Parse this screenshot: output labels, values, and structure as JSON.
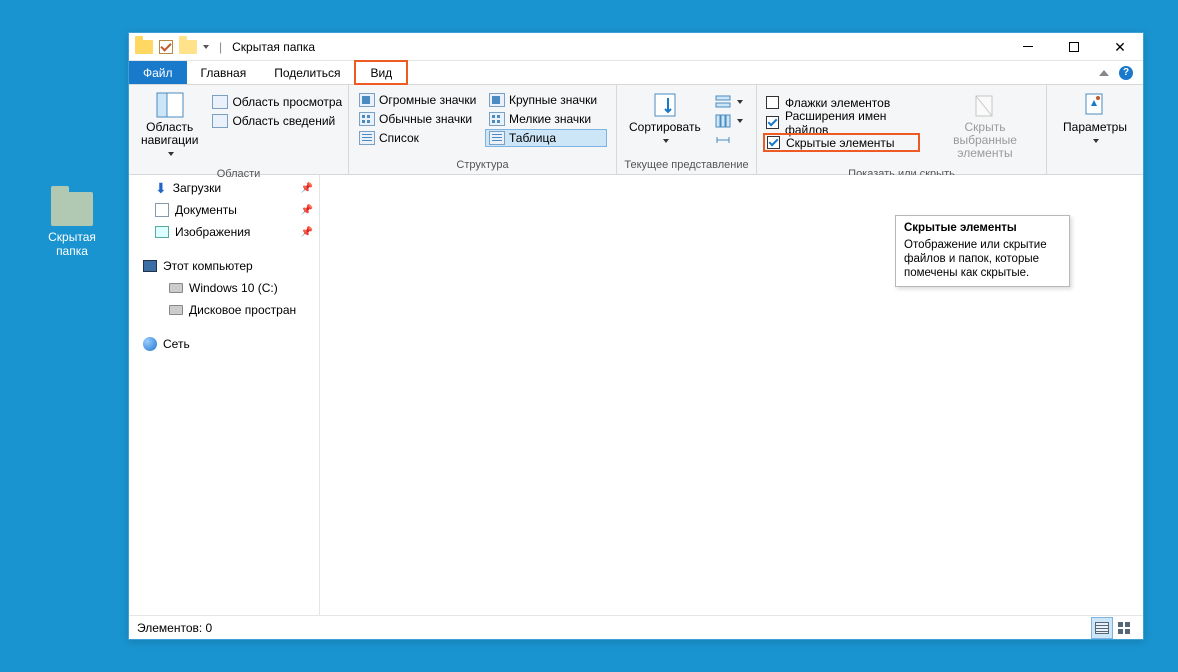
{
  "desktop": {
    "folder_label_l1": "Скрытая",
    "folder_label_l2": "папка"
  },
  "titlebar": {
    "title": "Скрытая папка"
  },
  "tabs": {
    "file": "Файл",
    "home": "Главная",
    "share": "Поделиться",
    "view": "Вид"
  },
  "ribbon": {
    "panes": {
      "nav_l1": "Область",
      "nav_l2": "навигации",
      "preview": "Область просмотра",
      "details": "Область сведений",
      "group": "Области"
    },
    "layout": {
      "xl": "Огромные значки",
      "lg": "Крупные значки",
      "md": "Обычные значки",
      "sm": "Мелкие значки",
      "list": "Список",
      "table": "Таблица",
      "group": "Структура"
    },
    "current": {
      "sort_l1": "Сортировать",
      "group": "Текущее представление"
    },
    "showhide": {
      "item_checkboxes": "Флажки элементов",
      "file_ext": "Расширения имен файлов",
      "hidden": "Скрытые элементы",
      "hide_sel_l1": "Скрыть выбранные",
      "hide_sel_l2": "элементы",
      "group": "Показать или скрыть"
    },
    "options": {
      "label": "Параметры"
    }
  },
  "tree": {
    "downloads": "Загрузки",
    "documents": "Документы",
    "pictures": "Изображения",
    "this_pc": "Этот компьютер",
    "drive_c": "Windows 10 (C:)",
    "drive_d": "Дисковое простран",
    "network": "Сеть"
  },
  "tooltip": {
    "title": "Скрытые элементы",
    "body": "Отображение или скрытие файлов и папок, которые помечены как скрытые."
  },
  "status": {
    "items": "Элементов: 0"
  }
}
